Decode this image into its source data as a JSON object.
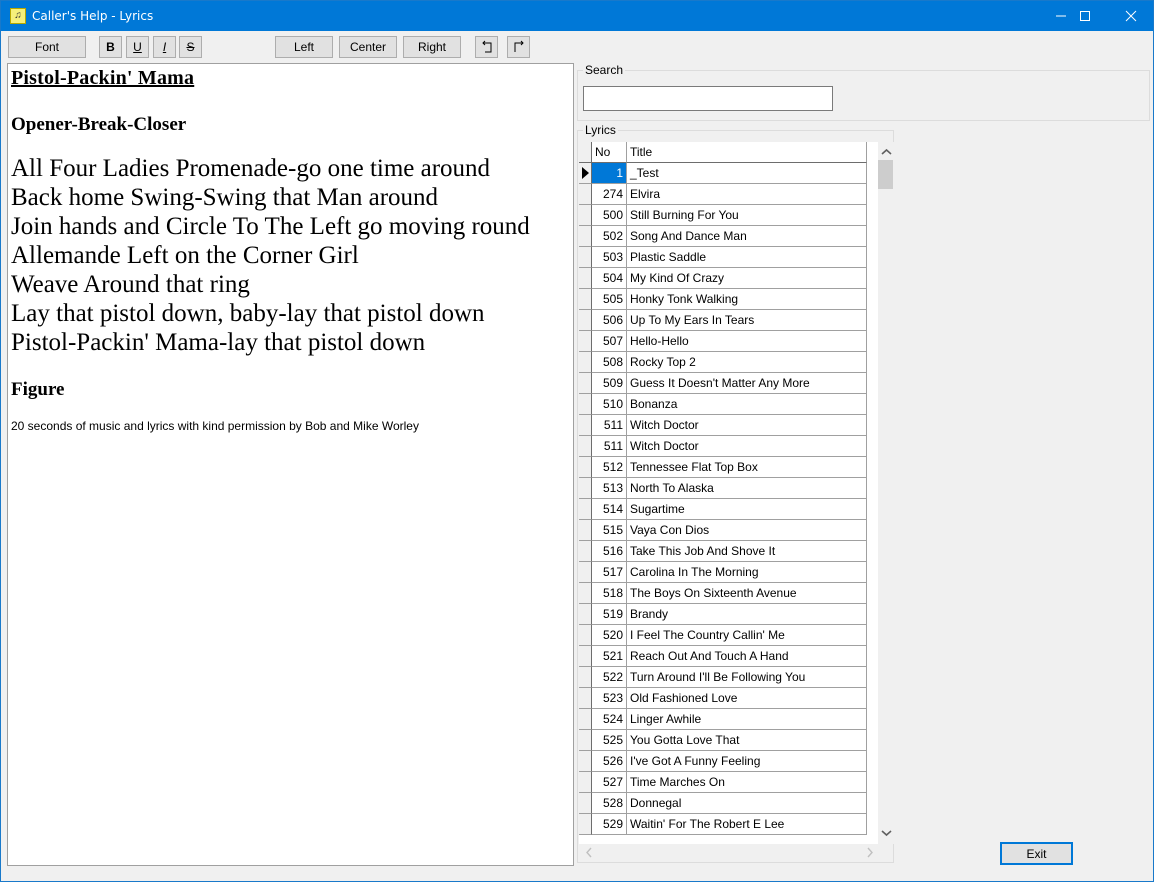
{
  "window": {
    "title": "Caller's Help - Lyrics",
    "minimize_label": "minimize",
    "maximize_label": "maximize",
    "close_label": "close"
  },
  "toolbar": {
    "font_label": "Font",
    "bold_label": "B",
    "underline_label": "U",
    "italic_label": "I",
    "strike_label": "S",
    "left_label": "Left",
    "center_label": "Center",
    "right_label": "Right",
    "indent_left_icon": "indent-left-icon",
    "indent_right_icon": "indent-right-icon"
  },
  "editor": {
    "title": "Pistol-Packin' Mama",
    "section1": "Opener-Break-Closer",
    "lines": [
      "All Four Ladies Promenade-go one time around",
      "Back home Swing-Swing that Man around",
      "Join hands and Circle To The Left go moving round",
      "Allemande Left on the Corner Girl",
      "Weave Around that ring",
      "Lay that pistol down, baby-lay that pistol down",
      "Pistol-Packin' Mama-lay that pistol down"
    ],
    "section2": "Figure",
    "note": "20 seconds of music and lyrics with kind permission by Bob and Mike Worley"
  },
  "search": {
    "group_label": "Search",
    "value": "",
    "placeholder": ""
  },
  "lyrics": {
    "group_label": "Lyrics",
    "columns": [
      "No",
      "Title"
    ],
    "selected_index": 0,
    "rows": [
      {
        "no": "1",
        "title": "_Test"
      },
      {
        "no": "274",
        "title": "Elvira"
      },
      {
        "no": "500",
        "title": "Still Burning For You"
      },
      {
        "no": "502",
        "title": "Song And Dance Man"
      },
      {
        "no": "503",
        "title": "Plastic Saddle"
      },
      {
        "no": "504",
        "title": "My Kind Of Crazy"
      },
      {
        "no": "505",
        "title": "Honky Tonk Walking"
      },
      {
        "no": "506",
        "title": "Up To My Ears In Tears"
      },
      {
        "no": "507",
        "title": "Hello-Hello"
      },
      {
        "no": "508",
        "title": "Rocky Top 2"
      },
      {
        "no": "509",
        "title": "Guess It Doesn't Matter Any More"
      },
      {
        "no": "510",
        "title": "Bonanza"
      },
      {
        "no": "511",
        "title": "Witch Doctor"
      },
      {
        "no": "511",
        "title": "Witch Doctor"
      },
      {
        "no": "512",
        "title": "Tennessee Flat Top Box"
      },
      {
        "no": "513",
        "title": "North To Alaska"
      },
      {
        "no": "514",
        "title": "Sugartime"
      },
      {
        "no": "515",
        "title": "Vaya Con Dios"
      },
      {
        "no": "516",
        "title": "Take This Job And Shove It"
      },
      {
        "no": "517",
        "title": "Carolina In The Morning"
      },
      {
        "no": "518",
        "title": "The Boys On Sixteenth Avenue"
      },
      {
        "no": "519",
        "title": "Brandy"
      },
      {
        "no": "520",
        "title": "I Feel The Country Callin' Me"
      },
      {
        "no": "521",
        "title": "Reach Out And Touch A Hand"
      },
      {
        "no": "522",
        "title": "Turn Around I'll Be Following You"
      },
      {
        "no": "523",
        "title": "Old Fashioned Love"
      },
      {
        "no": "524",
        "title": "Linger Awhile"
      },
      {
        "no": "525",
        "title": "You Gotta Love That"
      },
      {
        "no": "526",
        "title": "I've Got A Funny Feeling"
      },
      {
        "no": "527",
        "title": "Time Marches On"
      },
      {
        "no": "528",
        "title": "Donnegal"
      },
      {
        "no": "529",
        "title": "Waitin' For The Robert E Lee"
      }
    ]
  },
  "footer": {
    "exit_label": "Exit"
  },
  "colors": {
    "titlebar": "#0078d7",
    "selection": "#0078d7",
    "background": "#f0f0f0"
  }
}
